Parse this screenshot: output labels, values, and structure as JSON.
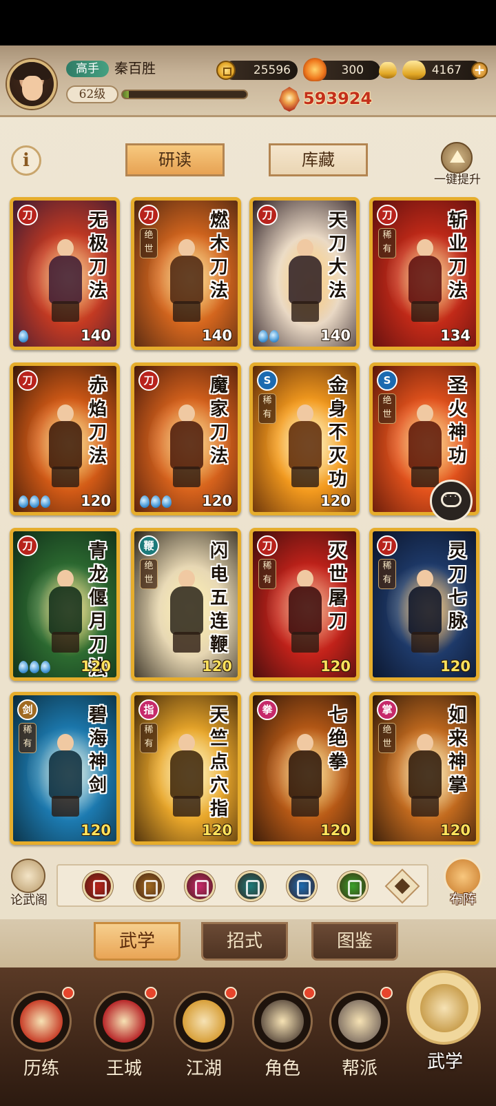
{
  "player": {
    "rank": "高手",
    "name": "秦百胜",
    "level": "62级",
    "exp_progress": 0.05,
    "power": "593924"
  },
  "resources": {
    "copper": "25596",
    "flame": "300",
    "gold": "4167"
  },
  "tabs": {
    "study": "研读",
    "collection": "库藏"
  },
  "upgrade_label": "一键提升",
  "cards": [
    {
      "title": "无极刀法",
      "level": "140",
      "badge": "",
      "type": "blade",
      "drops": 1,
      "colors": [
        "#3b1a33",
        "#c43a22",
        "#f2a24a"
      ]
    },
    {
      "title": "燃木刀法",
      "level": "140",
      "badge": "绝世",
      "type": "blade",
      "drops": 0,
      "colors": [
        "#4a2410",
        "#d4661e",
        "#f8c65a"
      ]
    },
    {
      "title": "天刀大法",
      "level": "140",
      "badge": "",
      "type": "blade",
      "drops": 2,
      "colors": [
        "#2a1c22",
        "#e9d8c4",
        "#f6b04a"
      ]
    },
    {
      "title": "斩业刀法",
      "level": "134",
      "badge": "稀有",
      "type": "blade",
      "drops": 0,
      "colors": [
        "#5a0e0e",
        "#c22a18",
        "#f6b25a"
      ]
    },
    {
      "title": "赤焰刀法",
      "level": "120",
      "badge": "",
      "type": "blade",
      "drops": 3,
      "colors": [
        "#3a1808",
        "#d25a16",
        "#f9c24e"
      ]
    },
    {
      "title": "魔家刀法",
      "level": "120",
      "badge": "",
      "type": "blade",
      "drops": 3,
      "colors": [
        "#4a1a0a",
        "#d6621c",
        "#f6b64a"
      ]
    },
    {
      "title": "金身不灭功",
      "level": "120",
      "badge": "稀有",
      "type": "force",
      "drops": 0,
      "colors": [
        "#5a2808",
        "#f39a1e",
        "#fff1b0"
      ]
    },
    {
      "title": "圣火神功",
      "level": "120",
      "badge": "绝世",
      "type": "force",
      "drops": 0,
      "colors": [
        "#5a1608",
        "#e2521c",
        "#f8b24a"
      ]
    },
    {
      "title": "青龙偃月刀法",
      "level": "120",
      "badge": "",
      "type": "blade",
      "drops": 3,
      "colors": [
        "#0e2a18",
        "#2c6a30",
        "#e8d25a"
      ]
    },
    {
      "title": "闪电五连鞭",
      "level": "120",
      "badge": "绝世",
      "type": "whip",
      "drops": 0,
      "colors": [
        "#2a241a",
        "#e6d6b2",
        "#f8e69a"
      ]
    },
    {
      "title": "灭世屠刀",
      "level": "120",
      "badge": "稀有",
      "type": "blade",
      "drops": 0,
      "colors": [
        "#3a0c0c",
        "#c2221a",
        "#e86a4a"
      ]
    },
    {
      "title": "灵刀七脉",
      "level": "120",
      "badge": "稀有",
      "type": "blade",
      "drops": 0,
      "colors": [
        "#0a1226",
        "#1e3a6a",
        "#f2a23a"
      ]
    },
    {
      "title": "碧海神剑",
      "level": "120",
      "badge": "稀有",
      "type": "sword",
      "drops": 0,
      "colors": [
        "#0a2a3a",
        "#1c7ab0",
        "#bfe8f8"
      ]
    },
    {
      "title": "天竺点穴指",
      "level": "120",
      "badge": "稀有",
      "type": "finger",
      "drops": 0,
      "colors": [
        "#3a2208",
        "#e8a62a",
        "#fff0a8"
      ]
    },
    {
      "title": "七绝拳",
      "level": "120",
      "badge": "",
      "type": "fist",
      "drops": 0,
      "colors": [
        "#2a1408",
        "#b85a16",
        "#f8c65a"
      ]
    },
    {
      "title": "如来神掌",
      "level": "120",
      "badge": "绝世",
      "type": "palm",
      "drops": 0,
      "colors": [
        "#2a1608",
        "#c26a1e",
        "#fbe3a0"
      ]
    }
  ],
  "filter": {
    "left_label": "论武阁",
    "right_label": "布阵",
    "icons": [
      {
        "name": "blade-filter-icon",
        "color": "#b8231c"
      },
      {
        "name": "sword-filter-icon",
        "color": "#a06a22"
      },
      {
        "name": "fist-filter-icon",
        "color": "#c62a6a"
      },
      {
        "name": "fan-filter-icon",
        "color": "#1c7a7a"
      },
      {
        "name": "taiji-filter-icon",
        "color": "#1c6ab0"
      },
      {
        "name": "spiral-filter-icon",
        "color": "#3aa02a"
      }
    ]
  },
  "subtabs": {
    "wuxue": "武学",
    "zhaoshi": "招式",
    "tujian": "图鉴"
  },
  "nav": [
    {
      "label": "历练",
      "color": "#c8402a"
    },
    {
      "label": "王城",
      "color": "#b8282a"
    },
    {
      "label": "江湖",
      "color": "#d8a03a"
    },
    {
      "label": "角色",
      "color": "#6a5a4a"
    },
    {
      "label": "帮派",
      "color": "#8a7a6a"
    },
    {
      "label": "武学",
      "color": "#caa050"
    }
  ]
}
